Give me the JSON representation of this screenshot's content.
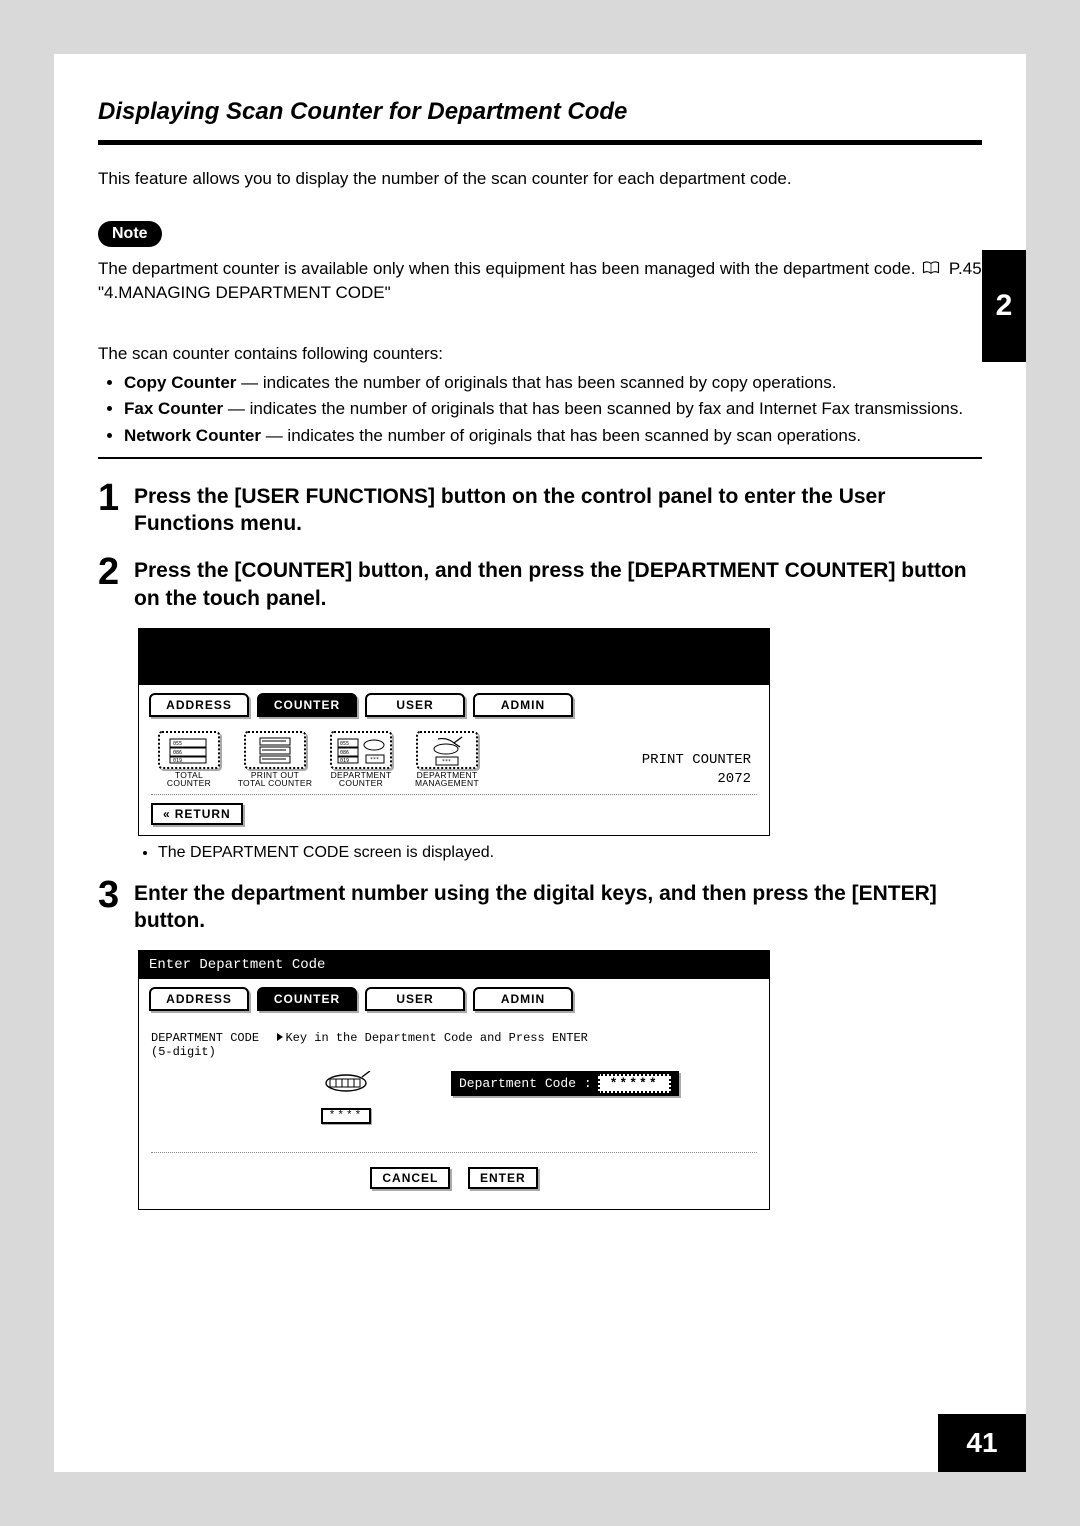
{
  "chapter_tab": "2",
  "page_number": "41",
  "section_title": "Displaying Scan Counter for Department Code",
  "intro": "This feature allows you to display the number of the scan counter for each department code.",
  "note_label": "Note",
  "note_text_before_ref": "The department counter is available only when this equipment has been managed with the department code.",
  "note_ref": " P.45 \"4.MANAGING DEPARTMENT CODE\"",
  "counters_intro": "The scan counter contains following counters:",
  "counters": [
    {
      "name": "Copy Counter",
      "desc": " — indicates the number of originals that has been scanned by copy operations."
    },
    {
      "name": "Fax Counter",
      "desc": " — indicates the number of originals that has been scanned by fax and Internet Fax transmissions."
    },
    {
      "name": "Network Counter",
      "desc": " — indicates the number of originals that has been scanned by scan operations."
    }
  ],
  "steps": {
    "1": "Press the [USER FUNCTIONS] button on the control panel to enter the User Functions menu.",
    "2": "Press the [COUNTER] button, and then press the [DEPARTMENT COUNTER] button on the touch panel.",
    "2_sub": "The DEPARTMENT CODE screen is displayed.",
    "3": "Enter the department number using the digital keys, and then press the [ENTER] button."
  },
  "panel1": {
    "tabs": [
      "ADDRESS",
      "COUNTER",
      "USER",
      "ADMIN"
    ],
    "active_tab_index": 1,
    "icons": [
      {
        "label_line1": "TOTAL",
        "label_line2": "COUNTER"
      },
      {
        "label_line1": "PRINT OUT",
        "label_line2": "TOTAL COUNTER"
      },
      {
        "label_line1": "DEPARTMENT",
        "label_line2": "COUNTER"
      },
      {
        "label_line1": "DEPARTMENT",
        "label_line2": "MANAGEMENT"
      }
    ],
    "print_counter_label": "PRINT COUNTER",
    "print_counter_value": "2072",
    "return_label": "RETURN"
  },
  "panel2": {
    "header": "Enter Department Code",
    "tabs": [
      "ADDRESS",
      "COUNTER",
      "USER",
      "ADMIN"
    ],
    "active_tab_index": 1,
    "instr_left": "DEPARTMENT CODE",
    "instr_right": "Key in the Department Code and Press ENTER",
    "instr_sub": "(5-digit)",
    "keypad_label": "****",
    "dc_label": "Department Code :",
    "dc_value": "*****",
    "cancel": "CANCEL",
    "enter": "ENTER"
  }
}
